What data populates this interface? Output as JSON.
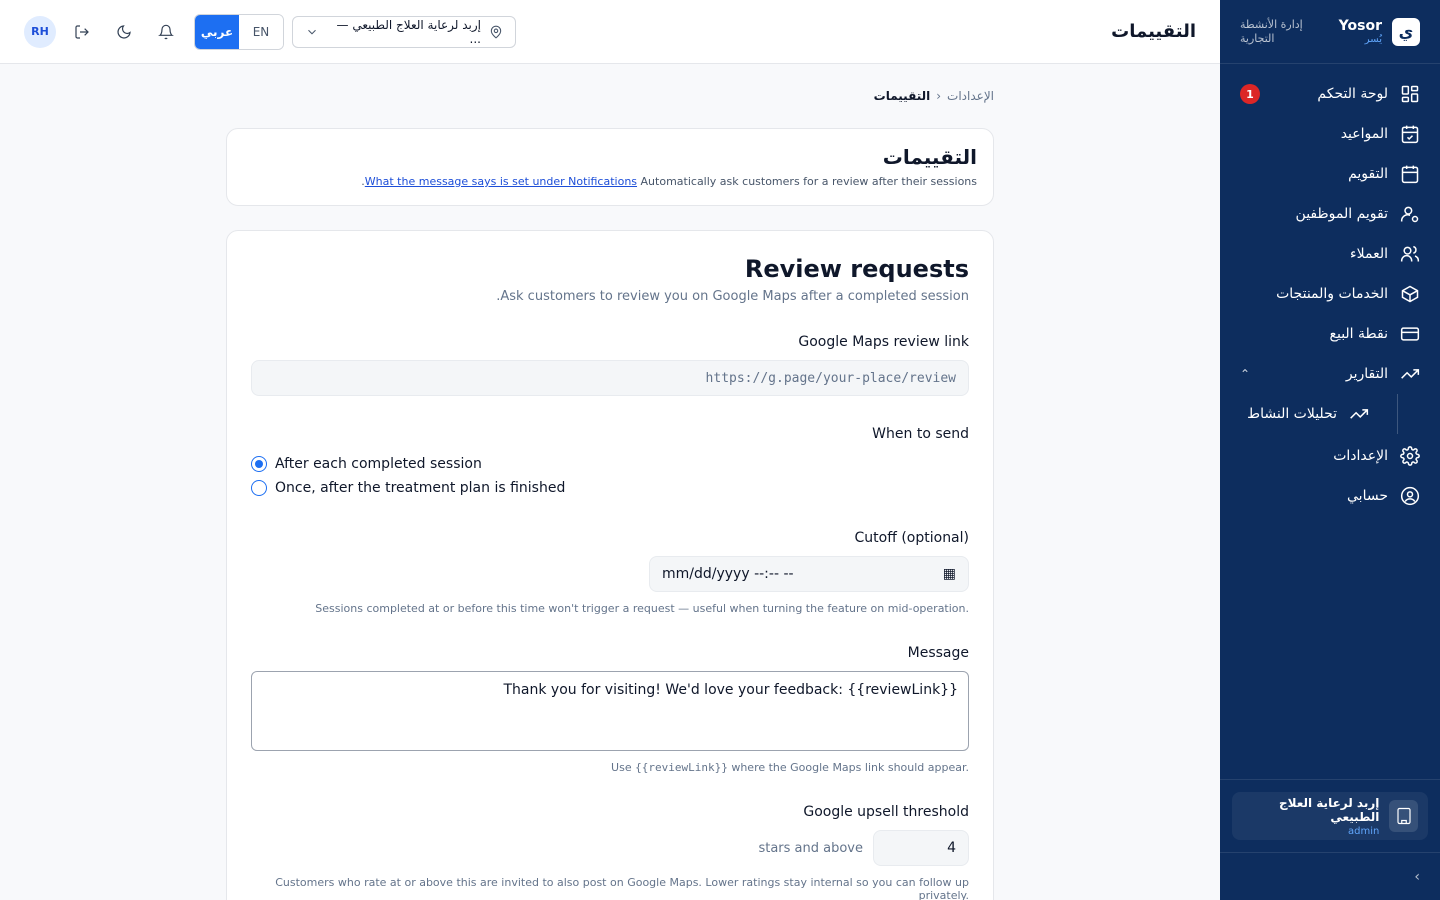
{
  "header": {
    "title": "التقييمات",
    "avatar": "RH",
    "lang_ar": "عربي",
    "lang_en": "EN",
    "location": "إربد لرعاية العلاج الطبيعي — ..."
  },
  "sidebar": {
    "brand_name": "Yosor",
    "brand_sub": "يُسر",
    "brand_tag": "إدارة الأنشطة التجارية",
    "items": [
      {
        "label": "لوحة التحكم",
        "icon": "dashboard-icon",
        "badge": "1"
      },
      {
        "label": "المواعيد",
        "icon": "calendar-check-icon"
      },
      {
        "label": "التقويم",
        "icon": "calendar-icon"
      },
      {
        "label": "تقويم الموظفين",
        "icon": "user-cog-icon"
      },
      {
        "label": "العملاء",
        "icon": "users-icon"
      },
      {
        "label": "الخدمات والمنتجات",
        "icon": "box-icon"
      },
      {
        "label": "نقطة البيع",
        "icon": "credit-card-icon"
      },
      {
        "label": "التقارير",
        "icon": "trending-up-icon"
      },
      {
        "label": "تحليلات النشاط",
        "icon": "trending-up-icon"
      },
      {
        "label": "الإعدادات",
        "icon": "gear-icon"
      },
      {
        "label": "حسابي",
        "icon": "user-circle-icon"
      }
    ],
    "org_name": "إربد لرعاية العلاج الطبيعي",
    "org_role": "admin"
  },
  "breadcrumb": {
    "parent": "الإعدادات",
    "current": "التقييمات"
  },
  "intro_card": {
    "title": "التقييمات",
    "text": "Automatically ask customers for a review after their sessions.",
    "link": "What the message says is set under Notifications"
  },
  "review_card": {
    "title": "Review requests",
    "subtitle": "Ask customers to review you on Google Maps after a completed session.",
    "maps_label": "Google Maps review link",
    "maps_placeholder": "https://g.page/your-place/review",
    "when_label": "When to send",
    "option_each": "After each completed session",
    "option_once": "Once, after the treatment plan is finished",
    "cutoff_label": "Cutoff (optional)",
    "cutoff_value": "mm/dd/yyyy --:-- --",
    "cutoff_hint": "Sessions completed at or before this time won't trigger a request — useful when turning the feature on mid-operation.",
    "message_label": "Message",
    "message_value": "Thank you for visiting! We'd love your feedback: {{reviewLink}}",
    "message_hint_pre": "Use",
    "message_hint_code": "{{reviewLink}}",
    "message_hint_post": "where the Google Maps link should appear.",
    "threshold_label": "Google upsell threshold",
    "threshold_value": "4",
    "threshold_suffix": "stars and above",
    "threshold_hint": "Customers who rate at or above this are invited to also post on Google Maps. Lower ratings stay internal so you can follow up privately."
  }
}
